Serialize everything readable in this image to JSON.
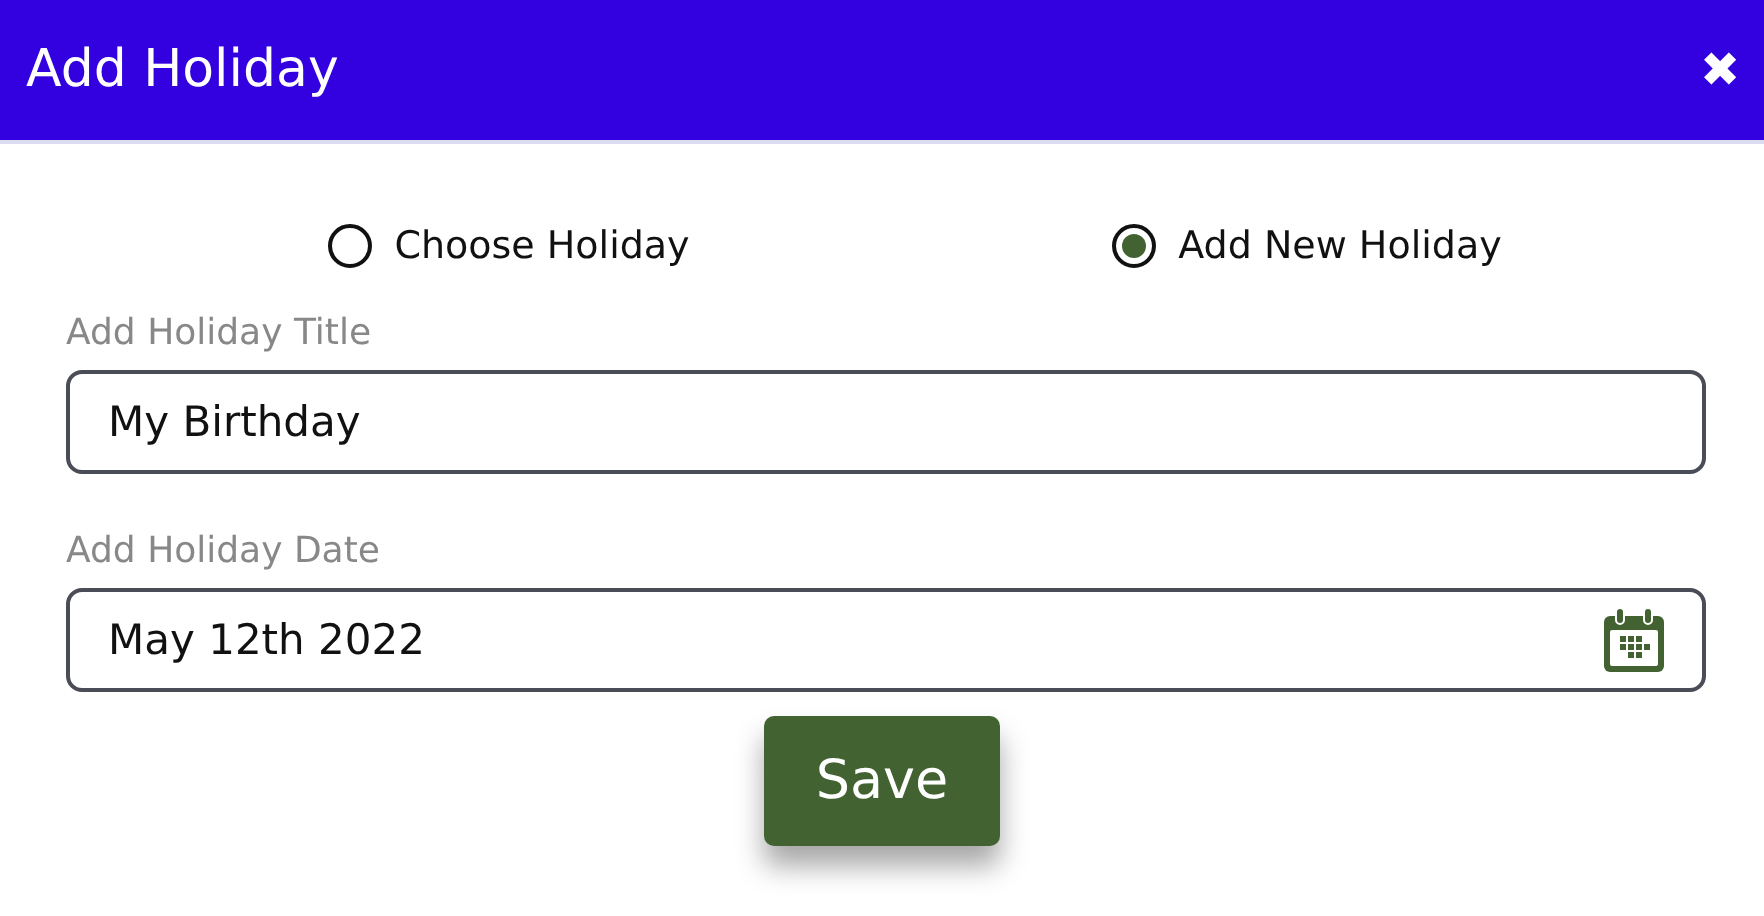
{
  "window": {
    "title": "Add Holiday",
    "close": "✖"
  },
  "options": [
    {
      "label": "Choose Holiday",
      "selected": false
    },
    {
      "label": "Add New Holiday",
      "selected": true
    }
  ],
  "fields": [
    {
      "kind": "text",
      "label": "Add Holiday Title",
      "value": "My Birthday"
    },
    {
      "kind": "date",
      "label": "Add Holiday Date",
      "value": "May 12th 2022"
    }
  ],
  "buttons": [
    "Save"
  ]
}
